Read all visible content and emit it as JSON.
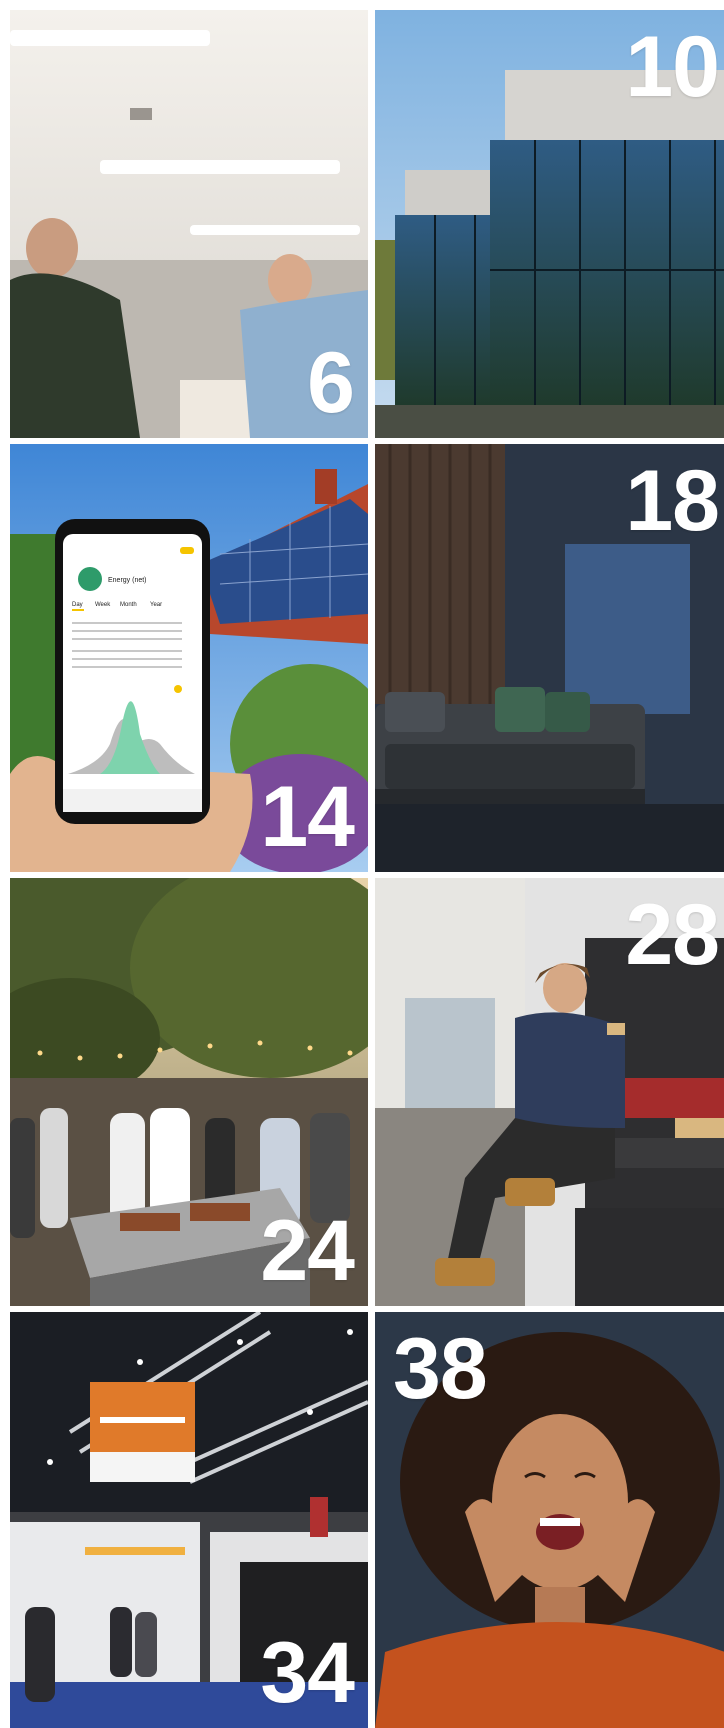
{
  "tiles": [
    {
      "page": "6",
      "scene": "two-men-office-ceiling-lights"
    },
    {
      "page": "10",
      "scene": "glass-facade-building-reflecting-trees"
    },
    {
      "page": "14",
      "scene": "hand-holding-phone-energy-app-solar-roof"
    },
    {
      "page": "18",
      "scene": "living-room-sofa-wall-panel"
    },
    {
      "page": "24",
      "scene": "outdoor-evening-barbecue-event"
    },
    {
      "page": "28",
      "scene": "installer-on-phone-sitting-in-van"
    },
    {
      "page": "34",
      "scene": "trade-fair-booth-hall"
    },
    {
      "page": "38",
      "scene": "excited-woman-curly-hair"
    }
  ],
  "phone_app": {
    "title": "Energy (net)",
    "tabs": [
      "Day",
      "Week",
      "Month",
      "Year"
    ],
    "accent": "#f5c400"
  },
  "colors": {
    "number_text": "#ffffff"
  }
}
